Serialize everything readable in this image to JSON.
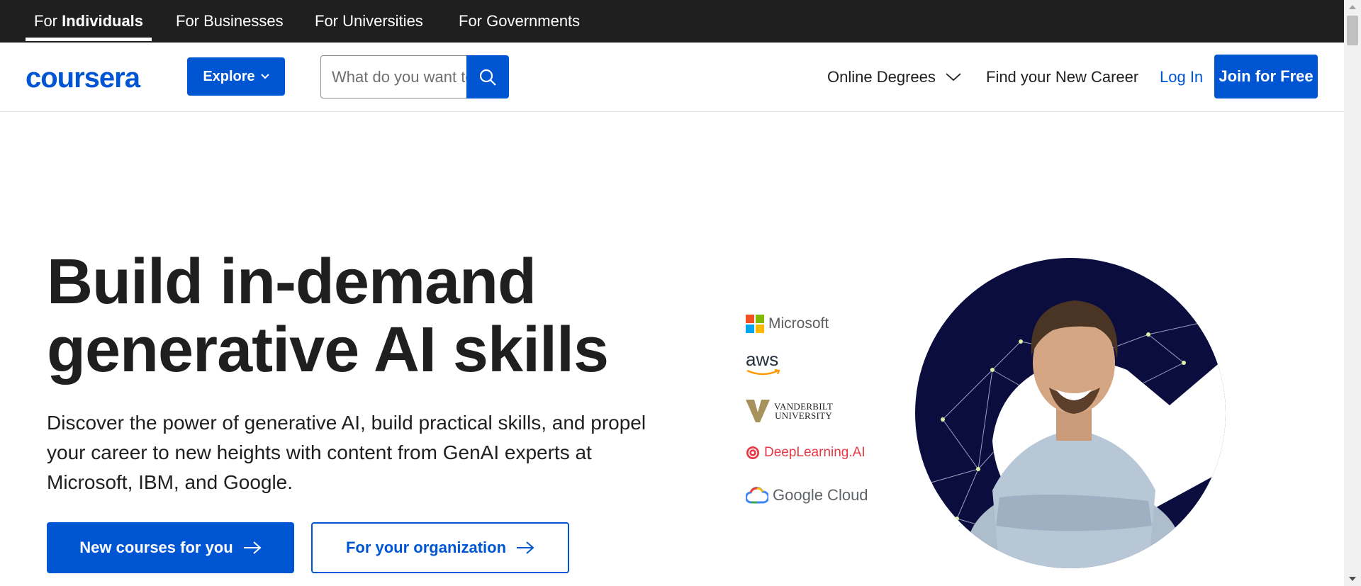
{
  "top_tabs": [
    {
      "prefix": "For ",
      "strong": "Individuals"
    },
    {
      "label": "For Businesses"
    },
    {
      "label": "For Universities"
    },
    {
      "label": "For Governments"
    }
  ],
  "header": {
    "logo_text": "coursera",
    "explore_label": "Explore",
    "search_placeholder": "What do you want to learn?",
    "nav": {
      "online_degrees": "Online Degrees",
      "find_career": "Find your New Career",
      "login": "Log In",
      "join": "Join for Free"
    }
  },
  "hero": {
    "title_line1": "Build in-demand",
    "title_line2": "generative AI skills",
    "description": "Discover the power of generative AI, build practical skills, and propel your career to new heights with content from GenAI experts at Microsoft, IBM, and Google.",
    "cta_primary": "New courses for you",
    "cta_secondary": "For your organization"
  },
  "partners": {
    "microsoft": "Microsoft",
    "aws": "aws",
    "vanderbilt_line1": "VANDERBILT",
    "vanderbilt_line2": "UNIVERSITY",
    "deeplearning": "DeepLearning.AI",
    "google_cloud": "Google Cloud"
  },
  "colors": {
    "brand_blue": "#0056d2",
    "topbar_bg": "#1f1f1f",
    "hero_circle": "#0b0d3f"
  }
}
